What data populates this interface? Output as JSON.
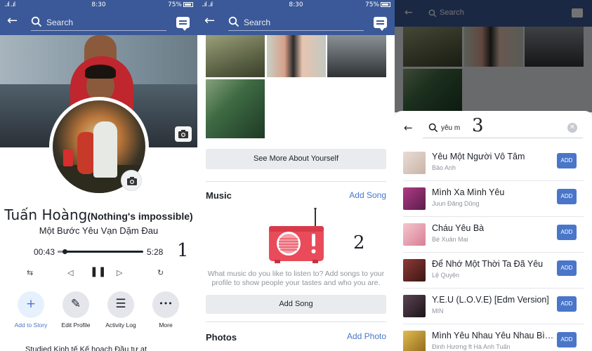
{
  "status": {
    "signal": "..ıl ..ıl",
    "time": "8:30",
    "battery": "75%"
  },
  "nav": {
    "search_placeholder": "Search"
  },
  "profile": {
    "name": "Tuấn Hoàng",
    "nickname": "(Nothing's impossible)",
    "song_title": "Một Bước Yêu Vạn Dặm Đau",
    "elapsed": "00:43",
    "duration": "5:28",
    "progress": 0.08,
    "annotation": "1",
    "controls": {
      "shuffle": "⇆",
      "prev": "◁",
      "pause": "❚❚",
      "next": "▷",
      "repeat": "↻"
    },
    "actions": [
      {
        "label": "Add to Story",
        "glyph": "+"
      },
      {
        "label": "Edit Profile",
        "glyph": "✎"
      },
      {
        "label": "Activity Log",
        "glyph": "☰"
      },
      {
        "label": "More",
        "glyph": "•••"
      }
    ],
    "cutoff_text": "Studied Kinh tế Kế hoạch Đầu tư at"
  },
  "about": {
    "see_more": "See More About Yourself",
    "music_title": "Music",
    "add_song_link": "Add Song",
    "annotation": "2",
    "music_prompt": "What music do you like to listen to? Add songs to your profile to show people your tastes and who you are.",
    "add_song_button": "Add Song",
    "photos_title": "Photos",
    "add_photo_link": "Add Photo"
  },
  "song_search": {
    "query": "yêu m",
    "clear": "✕",
    "annotation": "3",
    "add_label": "ADD",
    "results": [
      {
        "title": "Yêu Một Người Vô Tâm",
        "artist": "Bảo Anh",
        "color": "#d9c9c0"
      },
      {
        "title": "Mình Xa Mình Yêu",
        "artist": "Juun Đăng Dũng",
        "color": "#8a2e6a"
      },
      {
        "title": "Cháu Yêu Bà",
        "artist": "Bé Xuân Mai",
        "color": "#e7a5b1"
      },
      {
        "title": "Để Nhớ Một Thời Ta Đã Yêu",
        "artist": "Lệ Quyên",
        "color": "#6b2a28"
      },
      {
        "title": "Y.E.U (L.O.V.E) [Edm Version]",
        "artist": "MIN",
        "color": "#3a2a35"
      },
      {
        "title": "Mình Yêu Nhau Yêu Nhau Bình Yên",
        "artist": "Đinh Hương ft Hà Anh Tuấn",
        "color": "#c79a2e"
      }
    ]
  },
  "colors": {
    "brand": "#3b5998",
    "link": "#4a76c9",
    "radio": "#e94b5a"
  }
}
